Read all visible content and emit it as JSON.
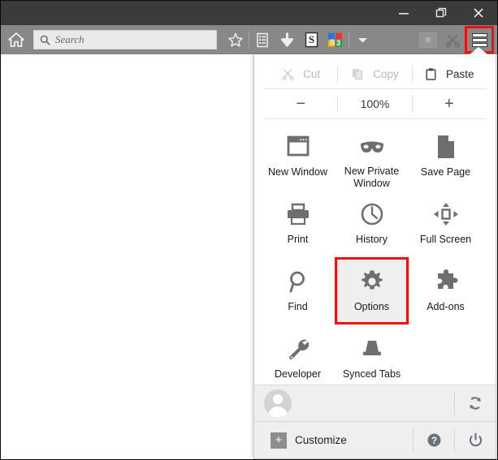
{
  "window": {
    "titlebar_buttons": [
      {
        "name": "minimize",
        "glyph": "minimize-icon"
      },
      {
        "name": "restore",
        "glyph": "restore-icon"
      },
      {
        "name": "close",
        "glyph": "close-icon"
      }
    ]
  },
  "toolbar": {
    "home_icon": "home-icon",
    "search": {
      "placeholder": "Search",
      "value": "",
      "icon": "search-icon"
    },
    "icons": [
      {
        "name": "bookmark-star-icon",
        "label": "Bookmark"
      },
      {
        "name": "reading-list-icon",
        "label": "Show sidebars"
      },
      {
        "name": "downloads-arrow-icon",
        "label": "Downloads"
      },
      {
        "name": "s-letter-icon",
        "label": "S"
      },
      {
        "name": "google-s3-icon",
        "label": "S3"
      },
      {
        "name": "chevron-down-icon",
        "label": "More"
      },
      {
        "name": "asterisk-box-icon",
        "label": "*"
      },
      {
        "name": "scissors-icon",
        "label": "Clip"
      }
    ],
    "menu_button": {
      "name": "hamburger-menu-button",
      "highlighted": true,
      "highlight_color": "#ee1111"
    }
  },
  "panel": {
    "edit_row": {
      "items": [
        {
          "label": "Cut",
          "icon": "scissors-icon",
          "enabled": false
        },
        {
          "label": "Copy",
          "icon": "copy-icon",
          "enabled": false
        },
        {
          "label": "Paste",
          "icon": "clipboard-icon",
          "enabled": true
        }
      ]
    },
    "zoom_row": {
      "minus": "−",
      "level": "100%",
      "plus": "+"
    },
    "grid": [
      {
        "label": "New Window",
        "icon": "new-window-icon",
        "highlighted": false
      },
      {
        "label": "New Private Window",
        "icon": "mask-icon",
        "highlighted": false
      },
      {
        "label": "Save Page",
        "icon": "page-icon",
        "highlighted": false
      },
      {
        "label": "Print",
        "icon": "printer-icon",
        "highlighted": false
      },
      {
        "label": "History",
        "icon": "clock-icon",
        "highlighted": false
      },
      {
        "label": "Full Screen",
        "icon": "fullscreen-icon",
        "highlighted": false
      },
      {
        "label": "Find",
        "icon": "magnifier-icon",
        "highlighted": false
      },
      {
        "label": "Options",
        "icon": "gear-icon",
        "highlighted": true
      },
      {
        "label": "Add-ons",
        "icon": "puzzle-icon",
        "highlighted": false
      },
      {
        "label": "Developer",
        "icon": "wrench-icon",
        "highlighted": false
      },
      {
        "label": "Synced Tabs",
        "icon": "synced-tabs-icon",
        "highlighted": false
      },
      {
        "label": "",
        "icon": "",
        "highlighted": false
      }
    ],
    "signin": {
      "avatar_icon": "avatar-icon",
      "label": "",
      "sync_icon": "sync-icon"
    },
    "footer": {
      "customize_label": "Customize",
      "plus_icon": "plus-icon",
      "help_icon": "help-icon",
      "power_icon": "power-icon"
    }
  },
  "colors": {
    "highlight": "#ee1111",
    "titlebar": "#3b3b3b",
    "toolbar": "#888888",
    "panel_bg": "#ffffff",
    "footer_bg": "#efefef"
  }
}
